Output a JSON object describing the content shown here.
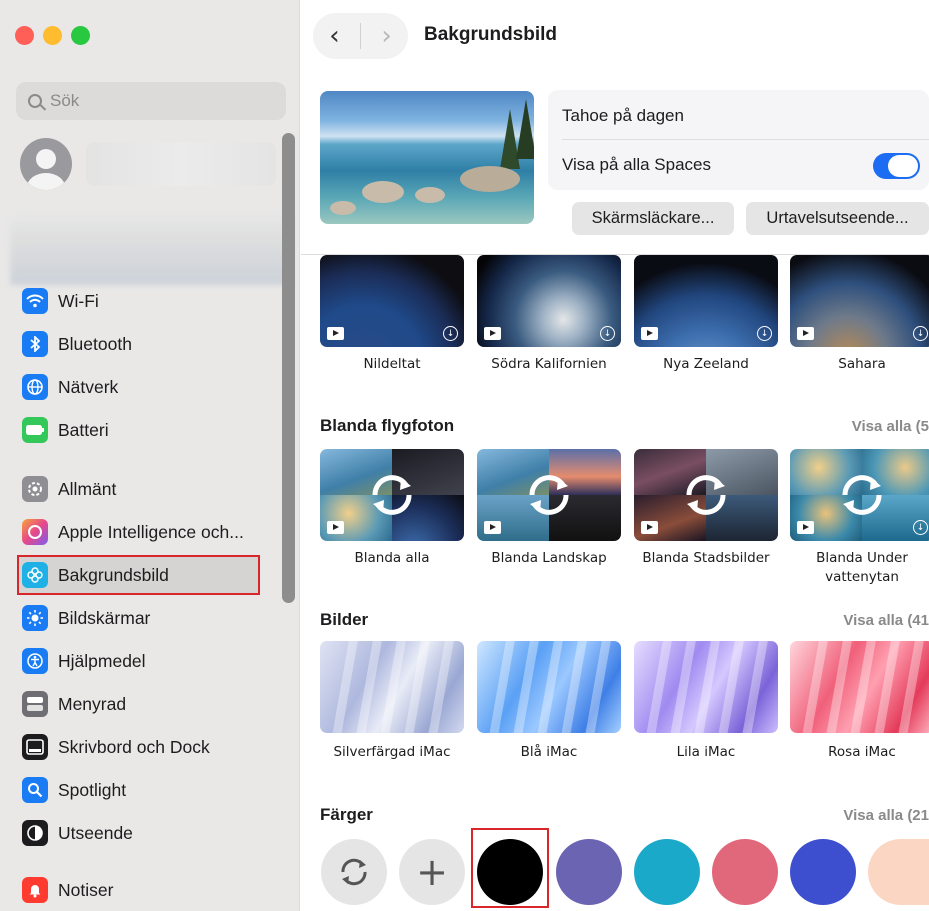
{
  "window": {
    "title": "Bakgrundsbild"
  },
  "search": {
    "placeholder": "Sök"
  },
  "sidebar": {
    "items": [
      {
        "label": "Wi-Fi",
        "icon": "wifi-icon",
        "color": "#1a7cf5"
      },
      {
        "label": "Bluetooth",
        "icon": "bluetooth-icon",
        "color": "#1a7cf5"
      },
      {
        "label": "Nätverk",
        "icon": "globe-icon",
        "color": "#1a7cf5"
      },
      {
        "label": "Batteri",
        "icon": "battery-icon",
        "color": "#34c759"
      },
      {
        "label": "Allmänt",
        "icon": "gear-icon",
        "color": "#8e8e93"
      },
      {
        "label": "Apple Intelligence och...",
        "icon": "apple-intelligence-icon",
        "color": "#f08a3c"
      },
      {
        "label": "Bakgrundsbild",
        "icon": "wallpaper-icon",
        "color": "#1fb1e6",
        "selected": true
      },
      {
        "label": "Bildskärmar",
        "icon": "display-brightness-icon",
        "color": "#1a7cf5"
      },
      {
        "label": "Hjälpmedel",
        "icon": "accessibility-icon",
        "color": "#1a7cf5"
      },
      {
        "label": "Menyrad",
        "icon": "menubar-icon",
        "color": "#6e6e73"
      },
      {
        "label": "Skrivbord och Dock",
        "icon": "desktop-dock-icon",
        "color": "#1c1c1e"
      },
      {
        "label": "Spotlight",
        "icon": "magnifier-icon",
        "color": "#1a7cf5"
      },
      {
        "label": "Utseende",
        "icon": "appearance-icon",
        "color": "#1c1c1e"
      },
      {
        "label": "Notiser",
        "icon": "notification-bell-icon",
        "color": "#ff3b30"
      }
    ]
  },
  "current": {
    "wallpaper_name": "Tahoe på dagen",
    "show_all_spaces_label": "Visa på alla Spaces",
    "show_all_spaces_on": true,
    "screensaver_button": "Skärmsläckare...",
    "clock_button": "Urtavelsutseende..."
  },
  "aerials": [
    "Nildeltat",
    "Södra Kalifornien",
    "Nya Zeeland",
    "Sahara"
  ],
  "shuffle": {
    "title": "Blanda flygfoton",
    "visa_alla": "Visa alla (5",
    "items": [
      "Blanda alla",
      "Blanda Landskap",
      "Blanda Stadsbilder",
      "Blanda Under vattenytan"
    ]
  },
  "pictures": {
    "title": "Bilder",
    "visa_alla": "Visa alla (41",
    "items": [
      "Silverfärgad iMac",
      "Blå iMac",
      "Lila iMac",
      "Rosa iMac"
    ]
  },
  "colors": {
    "title": "Färger",
    "visa_alla": "Visa alla (21",
    "swatches": [
      "#000000",
      "#6b64b2",
      "#1aa9c9",
      "#e0687a",
      "#3d4fcf",
      "#fbd6c2"
    ],
    "selected": "#000000"
  }
}
